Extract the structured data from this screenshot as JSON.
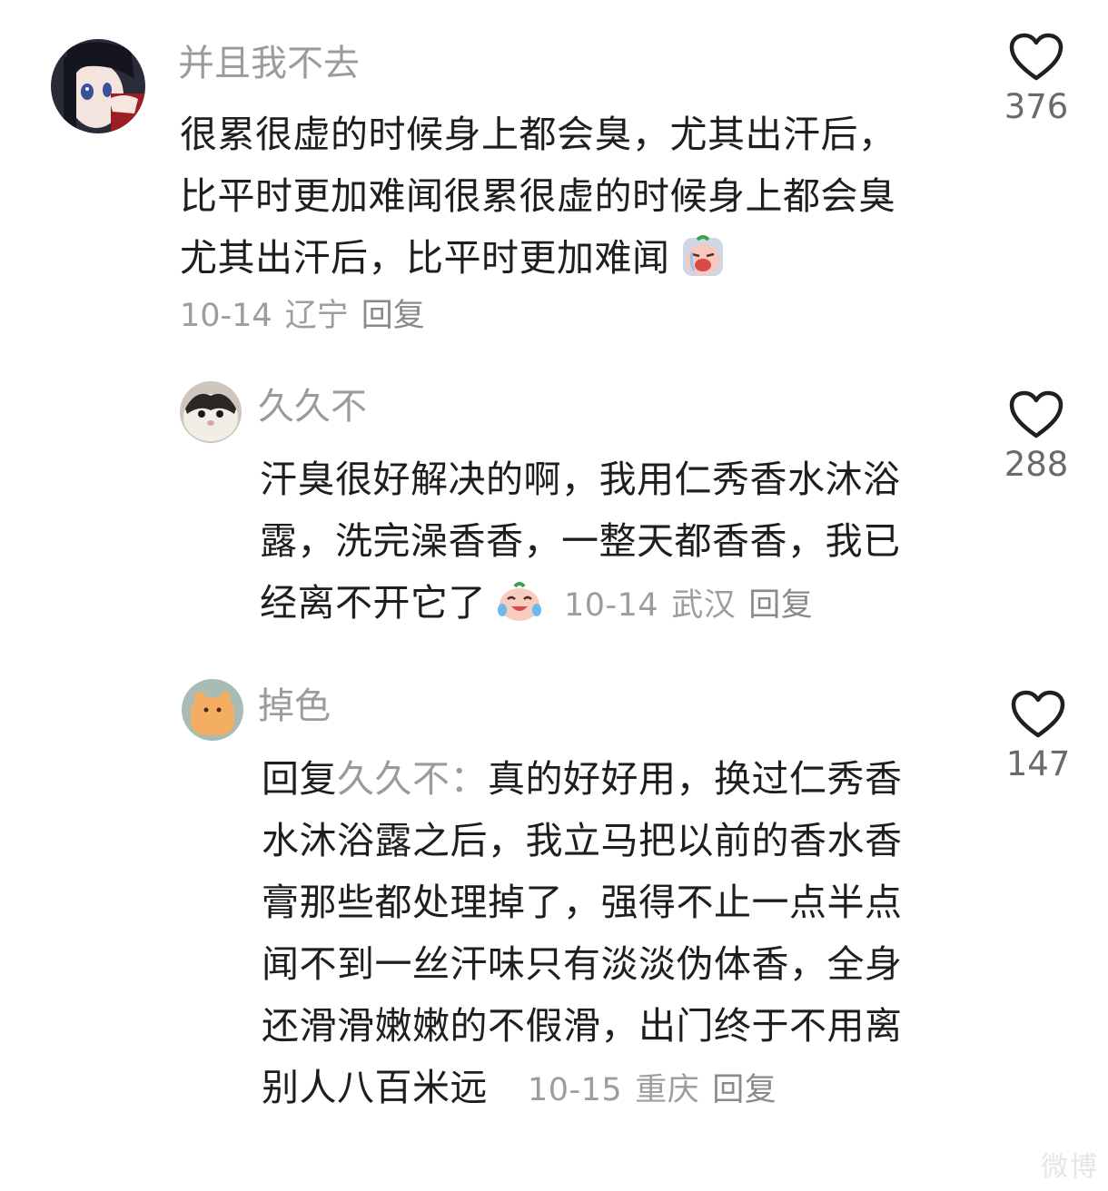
{
  "comments": [
    {
      "username": "并且我不去",
      "lines": [
        "很累很虚的时候身上都会臭，尤其出汗后，",
        "比平时更加难闻很累很虚的时候身上都会臭",
        "尤其出汗后，比平时更加难闻"
      ],
      "emoji": "crying-face-emoji",
      "date": "10-14",
      "location": "辽宁",
      "reply_label": "回复",
      "likes": "376"
    },
    {
      "username": "久久不",
      "lines": [
        "汗臭很好解决的啊，我用仁秀香水沐浴",
        "露，洗完澡香香，一整天都香香，我已",
        "经离不开它了"
      ],
      "emoji": "tears-of-joy-emoji",
      "date": "10-14",
      "location": "武汉",
      "reply_label": "回复",
      "likes": "288"
    },
    {
      "username": "掉色",
      "reply_prefix": "回复",
      "reply_to": "久久不：",
      "lines": [
        "真的好好用，换过仁秀香",
        "水沐浴露之后，我立马把以前的香水香",
        "膏那些都处理掉了，强得不止一点半点",
        "闻不到一丝汗味只有淡淡伪体香，全身",
        "还滑滑嫩嫩的不假滑，出门终于不用离",
        "别人八百米远"
      ],
      "date": "10-15",
      "location": "重庆",
      "reply_label": "回复",
      "likes": "147"
    }
  ],
  "icons": {
    "like": "heart-outline-icon"
  },
  "colors": {
    "username": "#9b9b9b",
    "body": "#1e1e1e",
    "meta": "#9d9d9d"
  },
  "watermark": "微博"
}
